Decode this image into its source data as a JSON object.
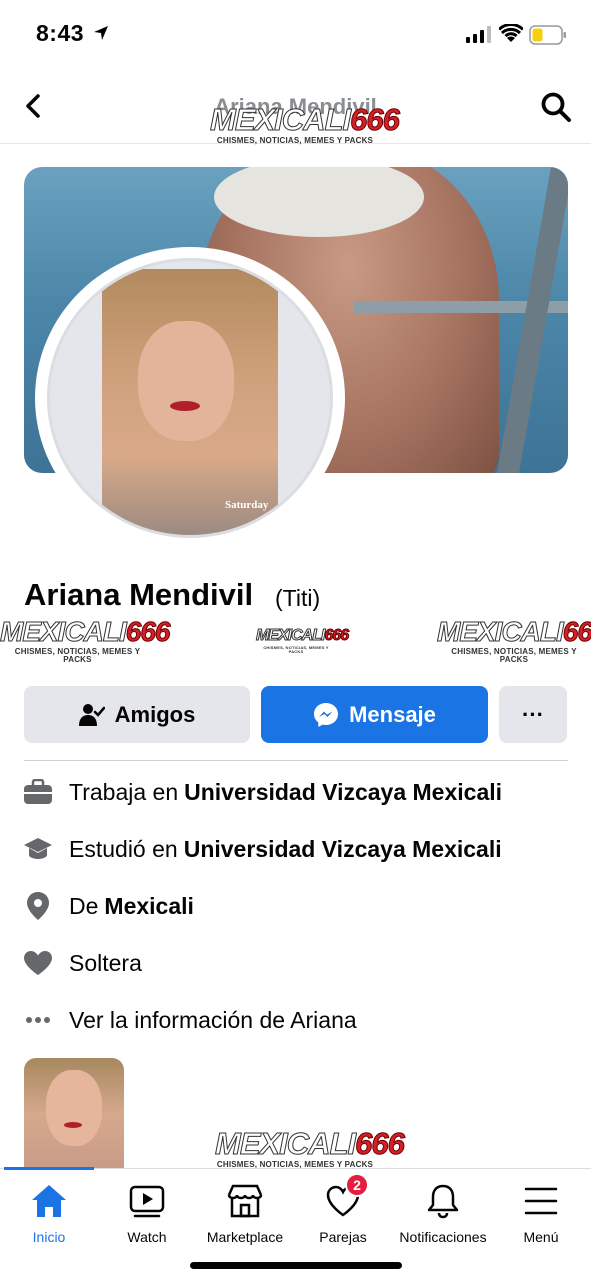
{
  "status_bar": {
    "time": "8:43",
    "icons": [
      "location-arrow-icon",
      "signal-icon",
      "wifi-icon",
      "battery-icon"
    ]
  },
  "header": {
    "title": "Ariana Mendivil",
    "back_icon": "chevron-left-icon",
    "search_icon": "search-icon"
  },
  "watermark": {
    "brand": "MEXICALI",
    "brand_number": "666",
    "tagline": "CHISMES, NOTICIAS, MEMES Y PACKS"
  },
  "avatar_caption": "Saturday",
  "profile": {
    "name": "Ariana Mendivil",
    "alias": "(Titi)"
  },
  "actions": {
    "friends_label": "Amigos",
    "message_label": "Mensaje",
    "more_label": "···"
  },
  "details": [
    {
      "icon": "briefcase-icon",
      "prefix": "Trabaja en",
      "value": "Universidad Vizcaya Mexicali"
    },
    {
      "icon": "graduation-cap-icon",
      "prefix": "Estudió en",
      "value": "Universidad Vizcaya Mexicali"
    },
    {
      "icon": "location-pin-icon",
      "prefix": "De",
      "value": "Mexicali"
    },
    {
      "icon": "heart-icon",
      "prefix": "Soltera",
      "value": ""
    },
    {
      "icon": "more-dots-icon",
      "prefix": "Ver la información de Ariana",
      "value": ""
    }
  ],
  "tabs": [
    {
      "label": "Inicio",
      "icon": "home-icon",
      "active": true
    },
    {
      "label": "Watch",
      "icon": "video-icon",
      "active": false
    },
    {
      "label": "Marketplace",
      "icon": "store-icon",
      "active": false
    },
    {
      "label": "Parejas",
      "icon": "dating-heart-icon",
      "active": false,
      "badge": "2"
    },
    {
      "label": "Notificaciones",
      "icon": "bell-icon",
      "active": false
    },
    {
      "label": "Menú",
      "icon": "menu-icon",
      "active": false
    }
  ],
  "colors": {
    "accent": "#1b74e4",
    "button_gray": "#e4e6eb",
    "badge": "#e41e3f",
    "watermark_red": "#d41f26"
  }
}
